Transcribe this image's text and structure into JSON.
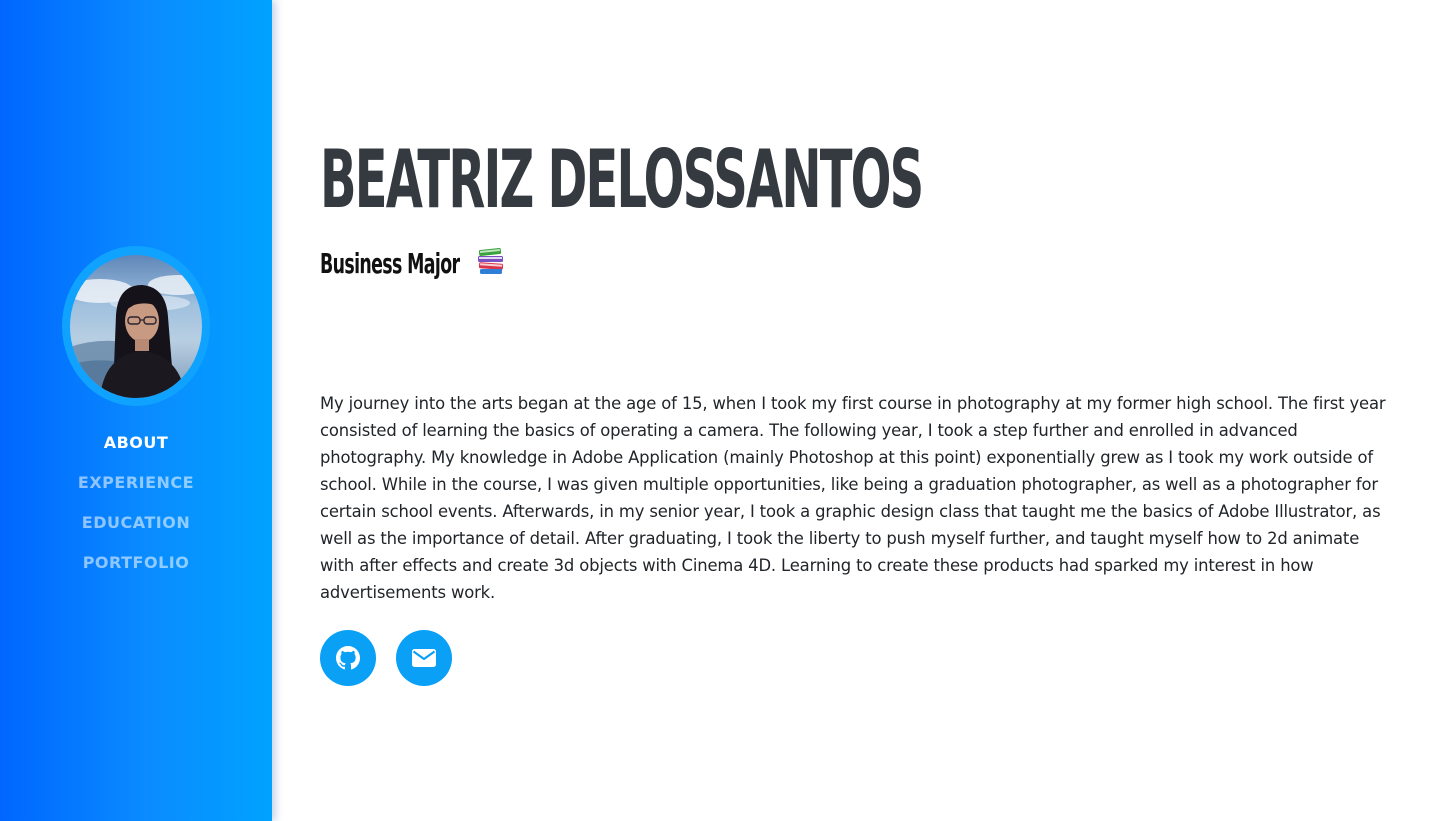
{
  "profile": {
    "name": "BEATRIZ DELOSSANTOS",
    "subtitle": "Business Major",
    "subtitle_icon": "books-icon",
    "bio": "My journey into the arts began at the age of 15, when I took my first course in photography at my former high school. The first year consisted of learning the basics of operating a camera. The following year, I took a step further and enrolled in advanced photography. My knowledge in Adobe Application (mainly Photoshop at this point) exponentially grew as I took my work outside of school. While in the course, I was given multiple opportunities, like being a graduation photographer, as well as a photographer for certain school events. Afterwards, in my senior year, I took a graphic design class that taught me the basics of Adobe Illustrator, as well as the importance of detail. After graduating, I took the liberty to push myself further, and taught myself how to 2d animate with after effects and create 3d objects with Cinema 4D. Learning to create these products had sparked my interest in how advertisements work."
  },
  "nav": {
    "items": [
      {
        "label": "ABOUT",
        "active": true
      },
      {
        "label": "EXPERIENCE",
        "active": false
      },
      {
        "label": "EDUCATION",
        "active": false
      },
      {
        "label": "PORTFOLIO",
        "active": false
      }
    ]
  },
  "social": [
    {
      "icon": "github-icon"
    },
    {
      "icon": "envelope-icon"
    }
  ],
  "colors": {
    "sidebar_gradient_start": "#0066ff",
    "sidebar_gradient_end": "#00a2ff",
    "accent": "#0aa0f6",
    "heading": "#343a40",
    "text": "#212529"
  }
}
